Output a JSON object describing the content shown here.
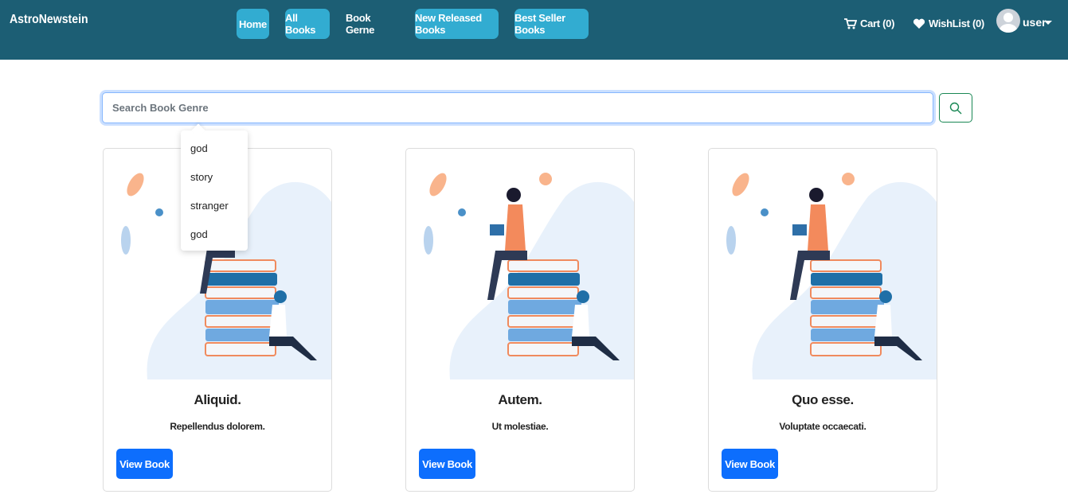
{
  "brand": "AstroNewstein",
  "nav": {
    "home": "Home",
    "all_books": "All Books",
    "book_genre": "Book Gerne",
    "new_released": "New Released Books",
    "best_seller": "Best Seller Books"
  },
  "cart": {
    "label": "Cart (0)",
    "icon": "cart-icon"
  },
  "wishlist": {
    "label": "WishList (0)",
    "icon": "heart-icon"
  },
  "user": {
    "name": "user"
  },
  "search": {
    "placeholder": "Search Book Genre",
    "value": ""
  },
  "suggestions": [
    "god",
    "story",
    "stranger",
    "god"
  ],
  "cards": [
    {
      "title": "Aliquid.",
      "text": "Repellendus dolorem.",
      "button": "View Book"
    },
    {
      "title": "Autem.",
      "text": "Ut molestiae.",
      "button": "View Book"
    },
    {
      "title": "Quo esse.",
      "text": "Voluptate occaecati.",
      "button": "View Book"
    }
  ],
  "colors": {
    "navbar": "#1c5e74",
    "nav_active": "#32acd1",
    "primary": "#0d6efd",
    "search_btn_border": "#198754"
  }
}
